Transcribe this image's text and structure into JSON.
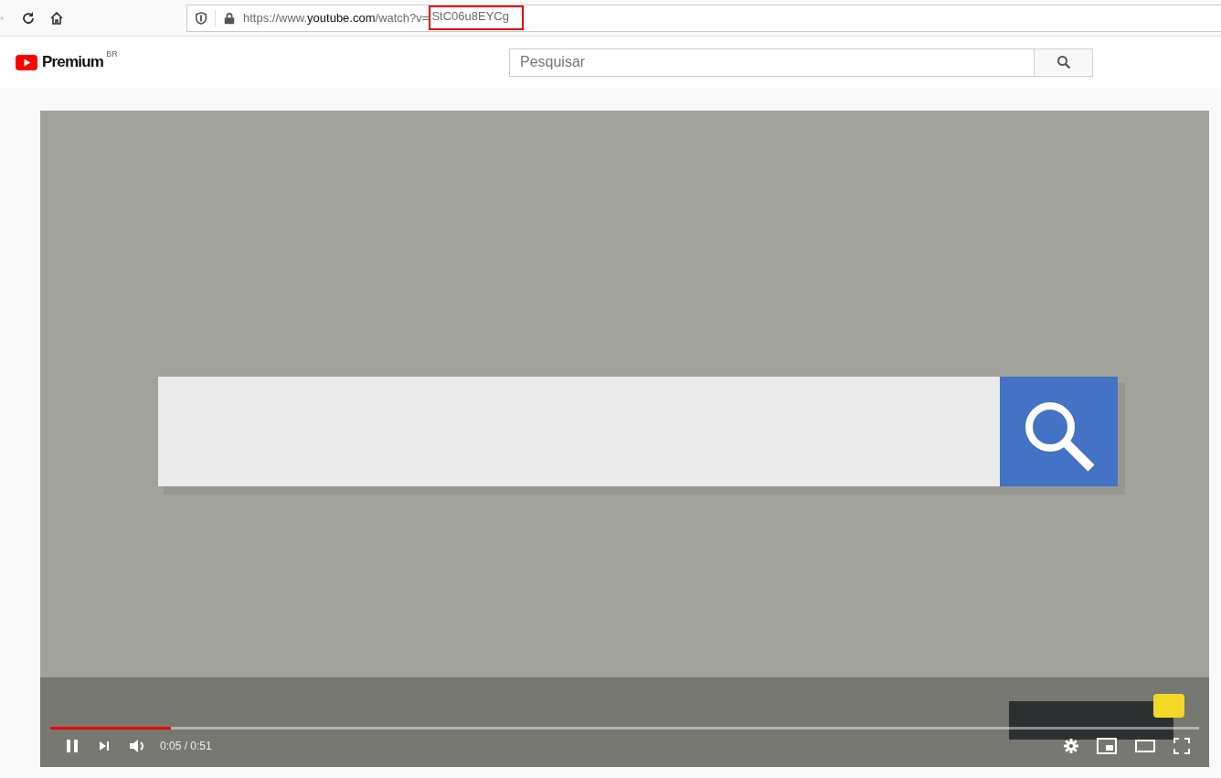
{
  "browser": {
    "url": [
      {
        "text": "https://www.",
        "kind": "dim"
      },
      {
        "text": "youtube.com",
        "kind": "host"
      },
      {
        "text": "/watch?v=",
        "kind": "dim"
      },
      {
        "text": "StC06u8EYCg",
        "kind": "marked"
      }
    ]
  },
  "header": {
    "logo": "Premium",
    "region": "BR",
    "search": {
      "placeholder": "Pesquisar"
    }
  },
  "player": {
    "progress": {
      "level": 0.105
    },
    "playing": true,
    "time": "0:05 / 0:51"
  }
}
